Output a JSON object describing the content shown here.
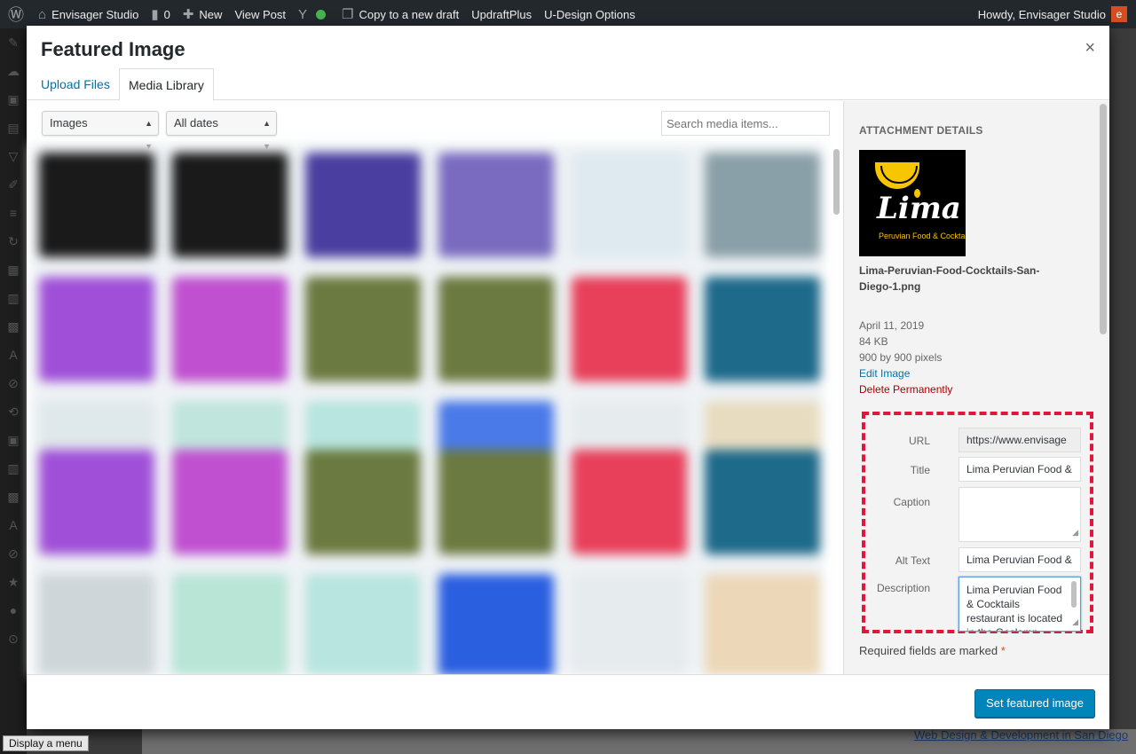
{
  "adminbar": {
    "site": "Envisager Studio",
    "comments": "0",
    "new": "New",
    "view_post": "View Post",
    "copy_draft": "Copy to a new draft",
    "updraft": "UpdraftPlus",
    "udesign": "U-Design Options",
    "howdy": "Howdy, Envisager Studio",
    "avatar": "e"
  },
  "modal": {
    "title": "Featured Image",
    "close": "×",
    "tabs": {
      "upload": "Upload Files",
      "library": "Media Library"
    }
  },
  "toolbar": {
    "type_filter": "Images",
    "date_filter": "All dates",
    "search_placeholder": "Search media items..."
  },
  "details": {
    "heading": "ATTACHMENT DETAILS",
    "logo_word": "Lima",
    "logo_tag": "Peruvian Food & Cocktails",
    "filename": "Lima-Peruvian-Food-Cocktails-San-Diego-1.png",
    "date": "April 11, 2019",
    "size": "84 KB",
    "dimensions": "900 by 900 pixels",
    "edit": "Edit Image",
    "delete": "Delete Permanently"
  },
  "fields": {
    "url_label": "URL",
    "url_value": "https://www.envisage",
    "title_label": "Title",
    "title_value": "Lima Peruvian Food &",
    "caption_label": "Caption",
    "caption_value": "",
    "alt_label": "Alt Text",
    "alt_value": "Lima Peruvian Food &",
    "desc_label": "Description",
    "desc_value": "Lima Peruvian Food & Cocktails restaurant is located in the Gaslamp District"
  },
  "required_note": "Required fields are marked",
  "required_star": "*",
  "set_button": "Set featured image",
  "menu_tip": "Display a menu",
  "background_link": "Web Design & Development in San Diego",
  "colors": {
    "primary": "#0085ba",
    "link": "#0073aa",
    "danger": "#a00",
    "highlight": "#e0163d"
  }
}
